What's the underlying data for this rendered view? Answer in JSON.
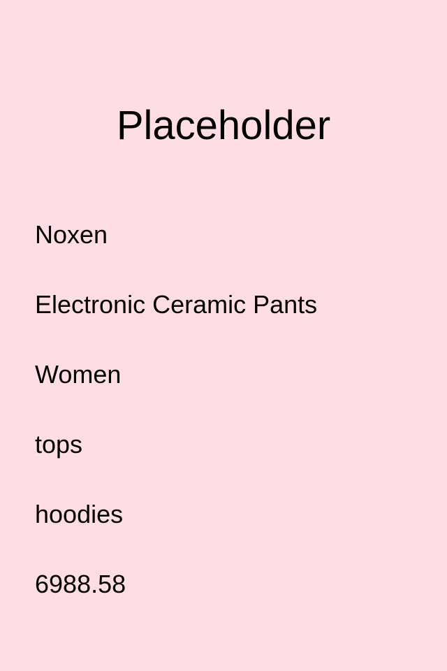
{
  "page": {
    "title": "Placeholder",
    "fields": {
      "brand": "Noxen",
      "product_name": "Electronic Ceramic Pants",
      "gender": "Women",
      "category": "tops",
      "subcategory": "hoodies",
      "price": "6988.58"
    },
    "colors": {
      "background": "#ffdde4",
      "text": "#000000"
    }
  }
}
